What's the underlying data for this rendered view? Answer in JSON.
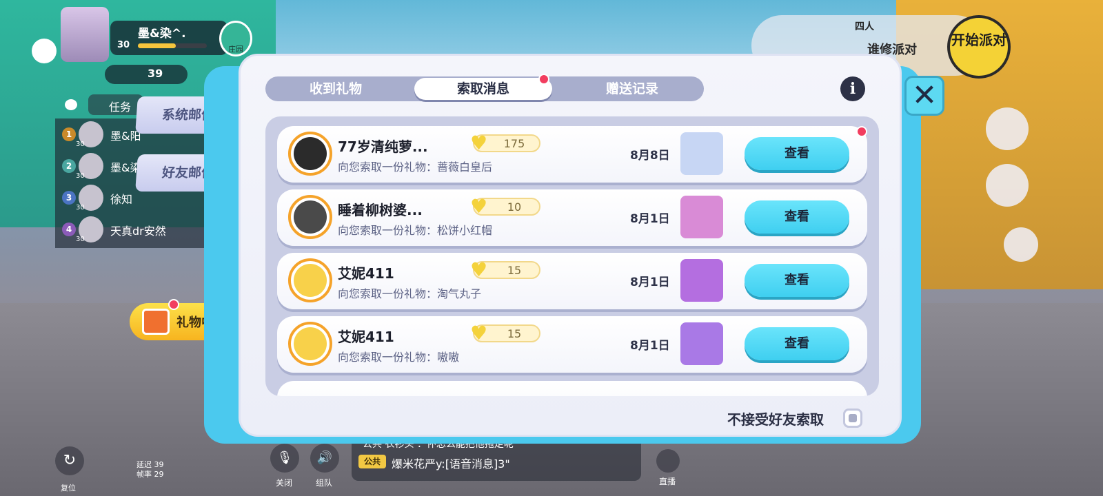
{
  "colors": {
    "accent_cyan": "#4bc9ee",
    "view_button": "#3fcff0",
    "notification_red": "#f23d5f",
    "modal_bg": "#f4f5fb",
    "segment_inactive": "#a8aecd"
  },
  "player": {
    "name": "墨&染^.",
    "level": "30",
    "coins": "39",
    "xp_fraction": 0.55
  },
  "hud_left": {
    "manor_label": "庄园",
    "task_label": "任务",
    "ranks": [
      {
        "rank": "1",
        "name": "墨&阳",
        "level": "30",
        "color": "#c98a2a"
      },
      {
        "rank": "2",
        "name": "墨&染",
        "level": "30",
        "color": "#4aa6a0"
      },
      {
        "rank": "3",
        "name": "徐知",
        "level": "30",
        "color": "#4b74c2"
      },
      {
        "rank": "4",
        "name": "天真dr安然",
        "level": "30",
        "color": "#8b5bb8"
      }
    ],
    "mail_tabs": [
      "系统邮件",
      "好友邮件"
    ],
    "gift_center_label": "礼物中心"
  },
  "hud_bottom": {
    "reset_label": "复位",
    "latency_label": "延迟",
    "latency_value": "39",
    "fps_label": "帧率",
    "fps_value": "29",
    "mic_label": "关闭",
    "team_label": "组队",
    "chat_partial": "公共  衣衫头 ：怀忘么能把他拖走呢",
    "chat_tag": "公共",
    "chat_message": "爆米花严y:[语音消息]3\"",
    "live_label": "直播"
  },
  "hud_right": {
    "party_size": "四人",
    "party_mode": "谁修派对",
    "start_party": "开始派对"
  },
  "modal": {
    "tabs": [
      "收到礼物",
      "索取消息",
      "赠送记录"
    ],
    "active_tab": 1,
    "info_label": "i",
    "refuse_label": "不接受好友索取",
    "refuse_checked": false,
    "requests": [
      {
        "name": "77岁清纯萝...",
        "hearts": "175",
        "request": "向您索取一份礼物：蔷薇白皇后",
        "date": "8月8日",
        "button": "查看",
        "item_icon": "rose-queen-outfit-icon",
        "item_bg": "#c7d6f4",
        "avatar_bg": "#2b2b2b",
        "unread": true
      },
      {
        "name": "睡着柳树婆...",
        "hearts": "10",
        "request": "向您索取一份礼物：松饼小红帽",
        "date": "8月1日",
        "button": "查看",
        "item_icon": "red-hood-outfit-icon",
        "item_bg": "#d98bd6",
        "avatar_bg": "#4a4a4a",
        "unread": false
      },
      {
        "name": "艾妮411",
        "hearts": "15",
        "request": "向您索取一份礼物：淘气丸子",
        "date": "8月1日",
        "button": "查看",
        "item_icon": "naughty-dumpling-outfit-icon",
        "item_bg": "#b46ee0",
        "avatar_bg": "#f8d14a",
        "unread": false
      },
      {
        "name": "艾妮411",
        "hearts": "15",
        "request": "向您索取一份礼物：嗷嗷",
        "date": "8月1日",
        "button": "查看",
        "item_icon": "panda-outfit-icon",
        "item_bg": "#a979e6",
        "avatar_bg": "#f8d14a",
        "unread": false
      }
    ]
  }
}
